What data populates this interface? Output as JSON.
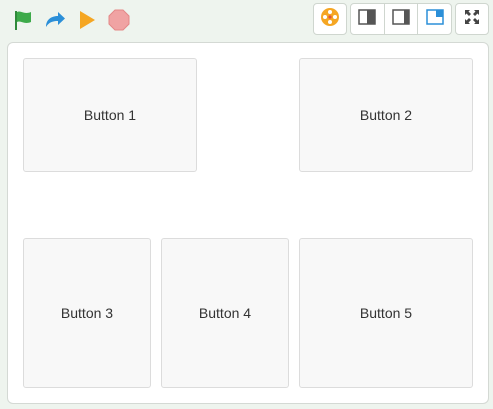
{
  "toolbar": {
    "left_icons": [
      "green-flag-icon",
      "redo-icon",
      "play-icon",
      "stop-icon"
    ],
    "right_icons": [
      "paint-palette-icon",
      "layout-left-pane-icon",
      "layout-right-pane-icon",
      "layout-corner-pane-icon",
      "fullscreen-icon"
    ],
    "active_layout": "layout-corner-pane-icon"
  },
  "colors": {
    "flag": "#3daa4a",
    "redo": "#2b8fd8",
    "play": "#f5a623",
    "stop": "#f0a3a3",
    "layout_active": "#2b8fd8",
    "layout_inactive": "#555555"
  },
  "stage": {
    "buttons": [
      {
        "label": "Button 1"
      },
      {
        "label": "Button 2"
      },
      {
        "label": "Button 3"
      },
      {
        "label": "Button 4"
      },
      {
        "label": "Button 5"
      }
    ]
  }
}
